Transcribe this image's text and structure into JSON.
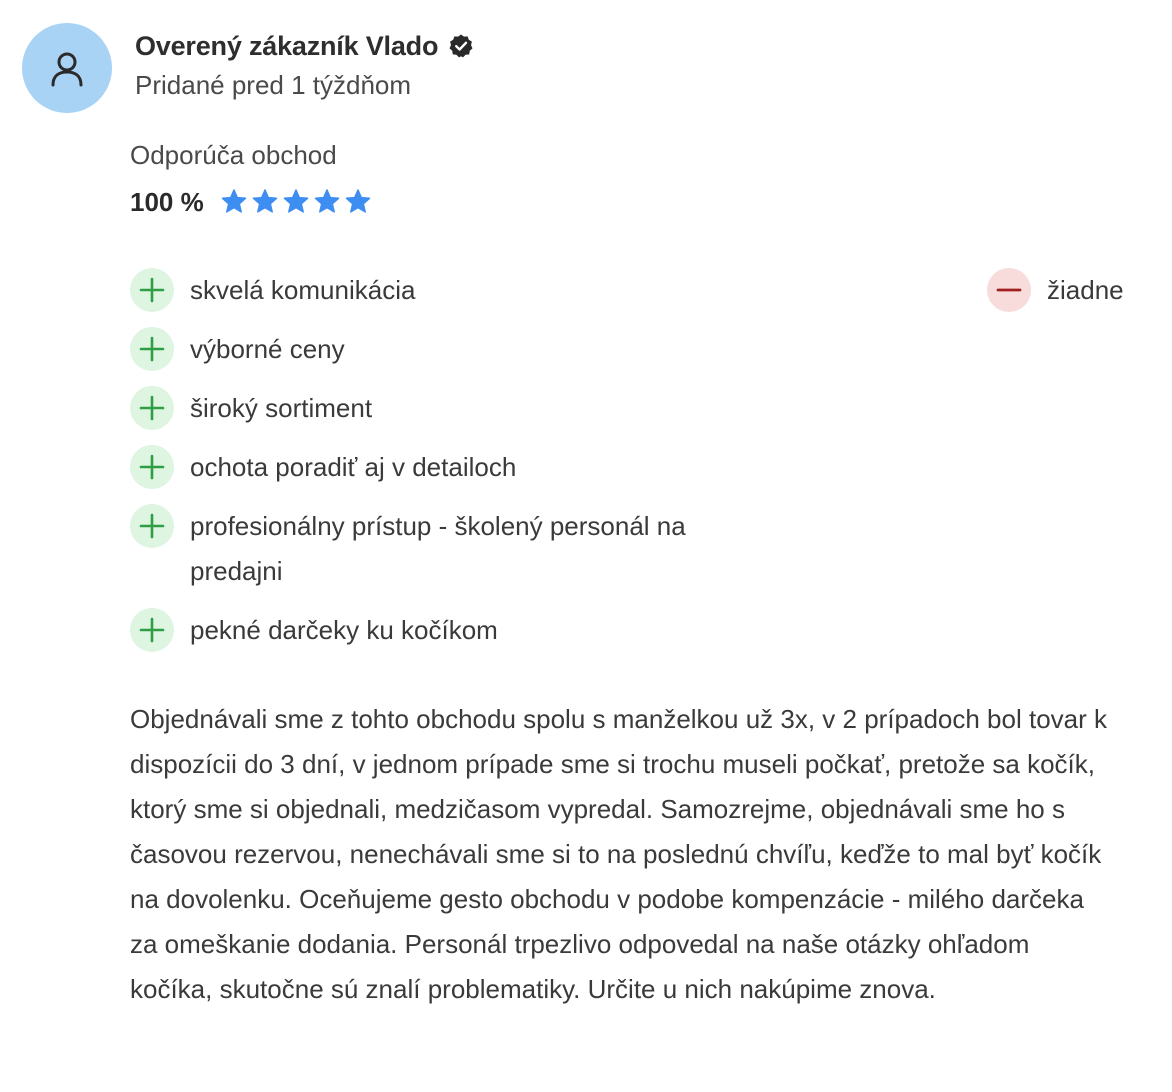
{
  "review": {
    "author": "Overený zákazník Vlado",
    "added": "Pridané pred 1 týždňom",
    "recommend_label": "Odporúča obchod",
    "percent": "100 %",
    "stars": 5,
    "star_color": "#3d8ef0",
    "pros": [
      "skvelá komunikácia",
      "výborné ceny",
      "široký sortiment",
      "ochota poradiť aj v detailoch",
      "profesionálny prístup - školený personál na predajni",
      "pekné darčeky ku kočíkom"
    ],
    "cons": [
      "žiadne"
    ],
    "text": "Objednávali sme z tohto obchodu spolu s manželkou už 3x, v 2 prípadoch bol tovar k dispozícii do 3 dní, v jednom prípade sme si trochu museli počkať, pretože sa kočík, ktorý sme si objednali, medzičasom vypredal. Samozrejme, objednávali sme ho s časovou rezervou, nenechávali sme si to na poslednú chvíľu, keďže to mal byť kočík na dovolenku. Oceňujeme gesto obchodu v podobe kompenzácie - milého darčeka za omeškanie dodania. Personál trpezlivo odpovedal na naše otázky ohľadom kočíka, skutočne sú znalí problematiky. Určite u nich nakúpime znova."
  },
  "icons": {
    "avatar": "user-icon",
    "verified": "check-badge-icon",
    "pro": "plus-icon",
    "con": "minus-icon"
  },
  "colors": {
    "avatar_bg": "#a8d3f5",
    "plus_bg": "#ddf5e1",
    "plus_fg": "#2f9e44",
    "minus_bg": "#f8dcdc",
    "minus_fg": "#a11f1f"
  }
}
